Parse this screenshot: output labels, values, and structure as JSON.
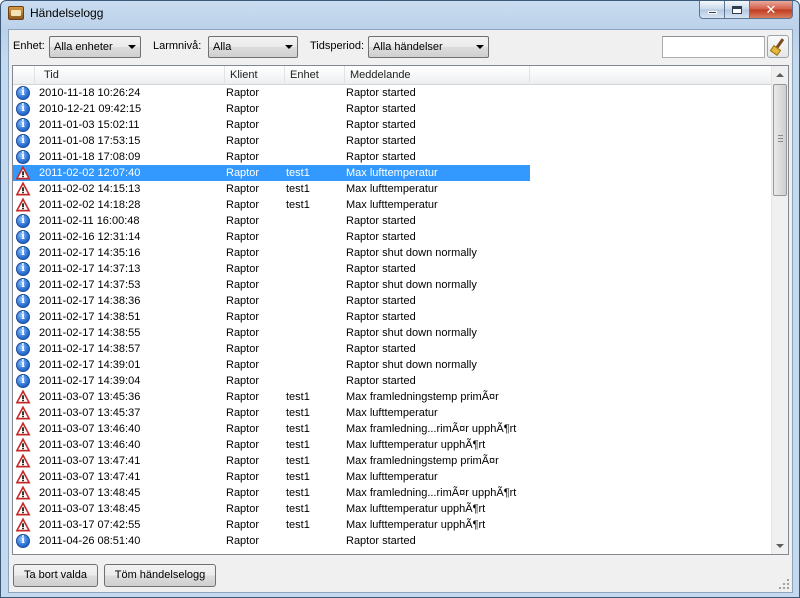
{
  "window": {
    "title": "Händelselogg"
  },
  "filters": {
    "enhet_label": "Enhet:",
    "enhet_value": "Alla enheter",
    "larmniva_label": "Larmnivå:",
    "larmniva_value": "Alla",
    "tidsperiod_label": "Tidsperiod:",
    "tidsperiod_value": "Alla händelser",
    "search_value": ""
  },
  "list": {
    "columns": [
      "Tid",
      "Klient",
      "Enhet",
      "Meddelande"
    ],
    "rows": [
      {
        "type": "info",
        "tid": "2010-11-18 10:26:24",
        "klient": "Raptor",
        "enhet": "",
        "meddelande": "Raptor started"
      },
      {
        "type": "info",
        "tid": "2010-12-21 09:42:15",
        "klient": "Raptor",
        "enhet": "",
        "meddelande": "Raptor started"
      },
      {
        "type": "info",
        "tid": "2011-01-03 15:02:11",
        "klient": "Raptor",
        "enhet": "",
        "meddelande": "Raptor started"
      },
      {
        "type": "info",
        "tid": "2011-01-08 17:53:15",
        "klient": "Raptor",
        "enhet": "",
        "meddelande": "Raptor started"
      },
      {
        "type": "info",
        "tid": "2011-01-18 17:08:09",
        "klient": "Raptor",
        "enhet": "",
        "meddelande": "Raptor started"
      },
      {
        "type": "warning",
        "tid": "2011-02-02 12:07:40",
        "klient": "Raptor",
        "enhet": "test1",
        "meddelande": "Max lufttemperatur",
        "selected": true
      },
      {
        "type": "warning",
        "tid": "2011-02-02 14:15:13",
        "klient": "Raptor",
        "enhet": "test1",
        "meddelande": "Max lufttemperatur"
      },
      {
        "type": "warning",
        "tid": "2011-02-02 14:18:28",
        "klient": "Raptor",
        "enhet": "test1",
        "meddelande": "Max lufttemperatur"
      },
      {
        "type": "info",
        "tid": "2011-02-11 16:00:48",
        "klient": "Raptor",
        "enhet": "",
        "meddelande": "Raptor started"
      },
      {
        "type": "info",
        "tid": "2011-02-16 12:31:14",
        "klient": "Raptor",
        "enhet": "",
        "meddelande": "Raptor started"
      },
      {
        "type": "info",
        "tid": "2011-02-17 14:35:16",
        "klient": "Raptor",
        "enhet": "",
        "meddelande": "Raptor shut down normally"
      },
      {
        "type": "info",
        "tid": "2011-02-17 14:37:13",
        "klient": "Raptor",
        "enhet": "",
        "meddelande": "Raptor started"
      },
      {
        "type": "info",
        "tid": "2011-02-17 14:37:53",
        "klient": "Raptor",
        "enhet": "",
        "meddelande": "Raptor shut down normally"
      },
      {
        "type": "info",
        "tid": "2011-02-17 14:38:36",
        "klient": "Raptor",
        "enhet": "",
        "meddelande": "Raptor started"
      },
      {
        "type": "info",
        "tid": "2011-02-17 14:38:51",
        "klient": "Raptor",
        "enhet": "",
        "meddelande": "Raptor started"
      },
      {
        "type": "info",
        "tid": "2011-02-17 14:38:55",
        "klient": "Raptor",
        "enhet": "",
        "meddelande": "Raptor shut down normally"
      },
      {
        "type": "info",
        "tid": "2011-02-17 14:38:57",
        "klient": "Raptor",
        "enhet": "",
        "meddelande": "Raptor started"
      },
      {
        "type": "info",
        "tid": "2011-02-17 14:39:01",
        "klient": "Raptor",
        "enhet": "",
        "meddelande": "Raptor shut down normally"
      },
      {
        "type": "info",
        "tid": "2011-02-17 14:39:04",
        "klient": "Raptor",
        "enhet": "",
        "meddelande": "Raptor started"
      },
      {
        "type": "warning",
        "tid": "2011-03-07 13:45:36",
        "klient": "Raptor",
        "enhet": "test1",
        "meddelande": "Max framledningstemp primÃ¤r"
      },
      {
        "type": "warning",
        "tid": "2011-03-07 13:45:37",
        "klient": "Raptor",
        "enhet": "test1",
        "meddelande": "Max lufttemperatur"
      },
      {
        "type": "warning",
        "tid": "2011-03-07 13:46:40",
        "klient": "Raptor",
        "enhet": "test1",
        "meddelande": "Max framledning...rimÃ¤r upphÃ¶rt"
      },
      {
        "type": "warning",
        "tid": "2011-03-07 13:46:40",
        "klient": "Raptor",
        "enhet": "test1",
        "meddelande": "Max lufttemperatur upphÃ¶rt"
      },
      {
        "type": "warning",
        "tid": "2011-03-07 13:47:41",
        "klient": "Raptor",
        "enhet": "test1",
        "meddelande": "Max framledningstemp primÃ¤r"
      },
      {
        "type": "warning",
        "tid": "2011-03-07 13:47:41",
        "klient": "Raptor",
        "enhet": "test1",
        "meddelande": "Max lufttemperatur"
      },
      {
        "type": "warning",
        "tid": "2011-03-07 13:48:45",
        "klient": "Raptor",
        "enhet": "test1",
        "meddelande": "Max framledning...rimÃ¤r upphÃ¶rt"
      },
      {
        "type": "warning",
        "tid": "2011-03-07 13:48:45",
        "klient": "Raptor",
        "enhet": "test1",
        "meddelande": "Max lufttemperatur upphÃ¶rt"
      },
      {
        "type": "warning",
        "tid": "2011-03-17 07:42:55",
        "klient": "Raptor",
        "enhet": "test1",
        "meddelande": "Max lufttemperatur upphÃ¶rt"
      },
      {
        "type": "info",
        "tid": "2011-04-26 08:51:40",
        "klient": "Raptor",
        "enhet": "",
        "meddelande": "Raptor started"
      }
    ]
  },
  "buttons": {
    "remove_selected": "Ta bort valda",
    "clear_log": "Töm händelselogg"
  },
  "colors": {
    "selection": "#3399ff",
    "info_icon": "#2a6fd6",
    "warning_icon": "#c62828"
  },
  "icons": {
    "info": "info-icon",
    "warning": "warning-icon",
    "clear_filter": "broom-icon"
  }
}
